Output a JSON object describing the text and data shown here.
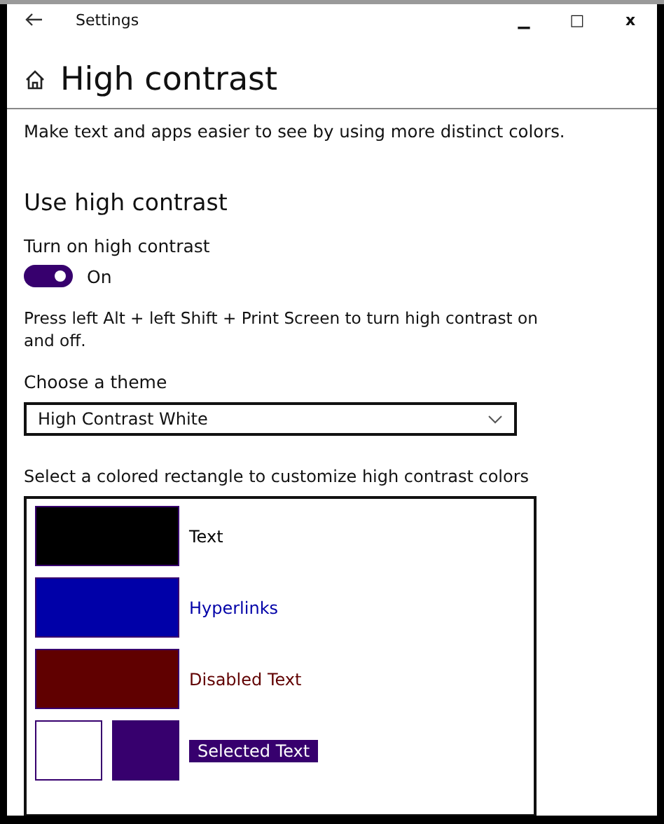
{
  "window": {
    "title": "Settings",
    "minimize": "▁",
    "maximize": "□",
    "close": "x"
  },
  "page": {
    "title": "High contrast",
    "description": "Make text and apps easier to see by using more distinct colors."
  },
  "section": {
    "title": "Use high contrast",
    "toggle": {
      "label": "Turn on high contrast",
      "on": true,
      "state_text": "On"
    },
    "hint": "Press left Alt + left Shift + Print Screen to turn high contrast on and off.",
    "theme": {
      "label": "Choose a theme",
      "value": "High Contrast White"
    },
    "colors_label": "Select a colored rectangle to customize high contrast colors",
    "colors": [
      {
        "kind": "single",
        "label": "Text",
        "swatches": [
          {
            "color": "#000000"
          }
        ]
      },
      {
        "kind": "single",
        "label": "Hyperlinks",
        "swatches": [
          {
            "color": "#0000a8"
          }
        ]
      },
      {
        "kind": "single",
        "label": "Disabled Text",
        "swatches": [
          {
            "color": "#600000"
          }
        ]
      },
      {
        "kind": "pair",
        "label": "Selected Text",
        "swatches": [
          {
            "color": "#ffffff"
          },
          {
            "color": "#37006e"
          }
        ]
      }
    ]
  }
}
